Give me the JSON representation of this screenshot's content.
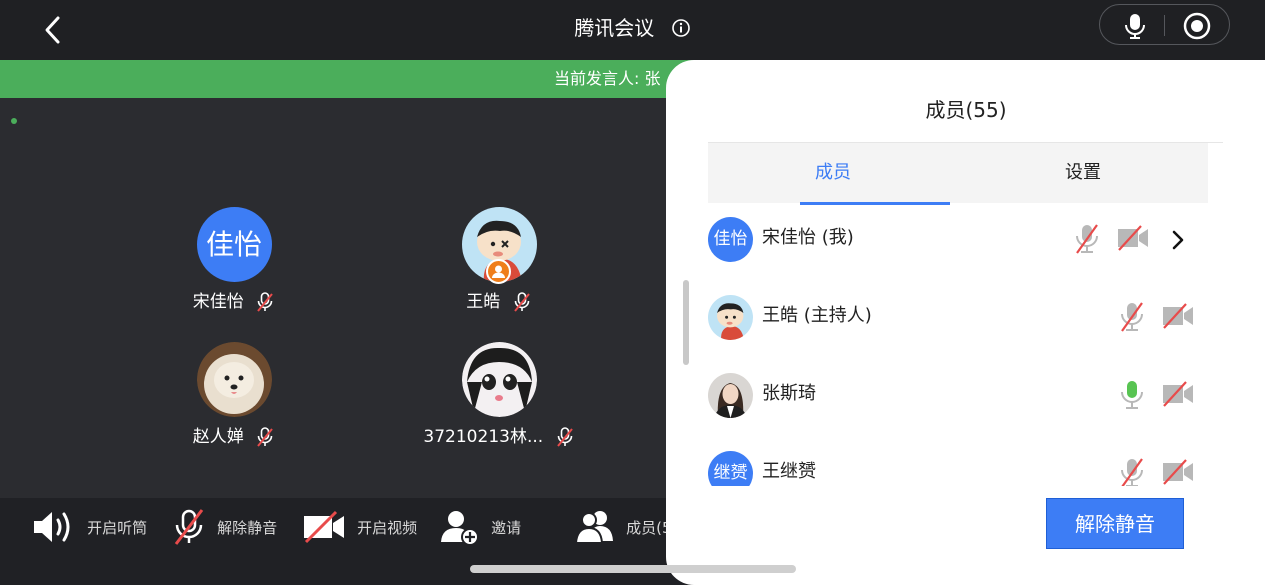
{
  "window": {
    "title": "腾讯会议"
  },
  "speaker_bar": {
    "text": "当前发言人: 张"
  },
  "gallery": {
    "tiles": [
      {
        "name": "宋佳怡",
        "avatar_text": "佳怡",
        "avatar_color": "#3D7DF5"
      },
      {
        "name": "王皓"
      },
      {
        "name": "赵人婵"
      },
      {
        "name": "37210213林..."
      }
    ]
  },
  "toolbar": {
    "speaker_label": "开启听筒",
    "mute_label": "解除静音",
    "video_label": "开启视频",
    "invite_label": "邀请",
    "members_label": "成员(5"
  },
  "panel": {
    "title": "成员(55)",
    "tabs": [
      {
        "label": "成员"
      },
      {
        "label": "设置"
      }
    ],
    "members": [
      {
        "name": "宋佳怡 (我)",
        "avatar_text": "佳怡",
        "mic": "muted",
        "camera": "off"
      },
      {
        "name": "王皓 (主持人)",
        "mic": "muted",
        "camera": "off"
      },
      {
        "name": "张斯琦",
        "mic": "active",
        "camera": "off"
      },
      {
        "name": "王继赟",
        "avatar_text": "继赟",
        "mic": "muted",
        "camera": "off"
      }
    ],
    "unmute_button": "解除静音"
  },
  "colors": {
    "accent": "#3D7DF5",
    "speaking": "#4BAE5B",
    "host_badge": "#EF7E1B"
  }
}
